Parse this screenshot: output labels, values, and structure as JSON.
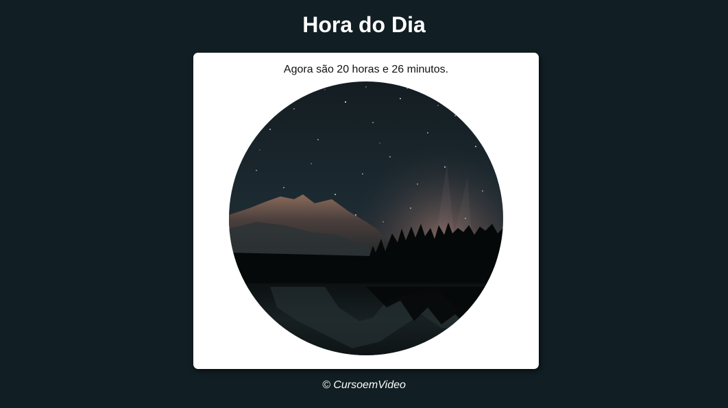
{
  "header": {
    "title": "Hora do Dia"
  },
  "main": {
    "time_message": "Agora são 20 horas e 26 minutos.",
    "image_subject": "night-landscape-mountains-lake"
  },
  "footer": {
    "copyright": "© CursoemVideo"
  },
  "colors": {
    "page_background": "#111e23",
    "card_background": "#ffffff",
    "title_text": "#ffffff",
    "body_text": "#111111"
  }
}
